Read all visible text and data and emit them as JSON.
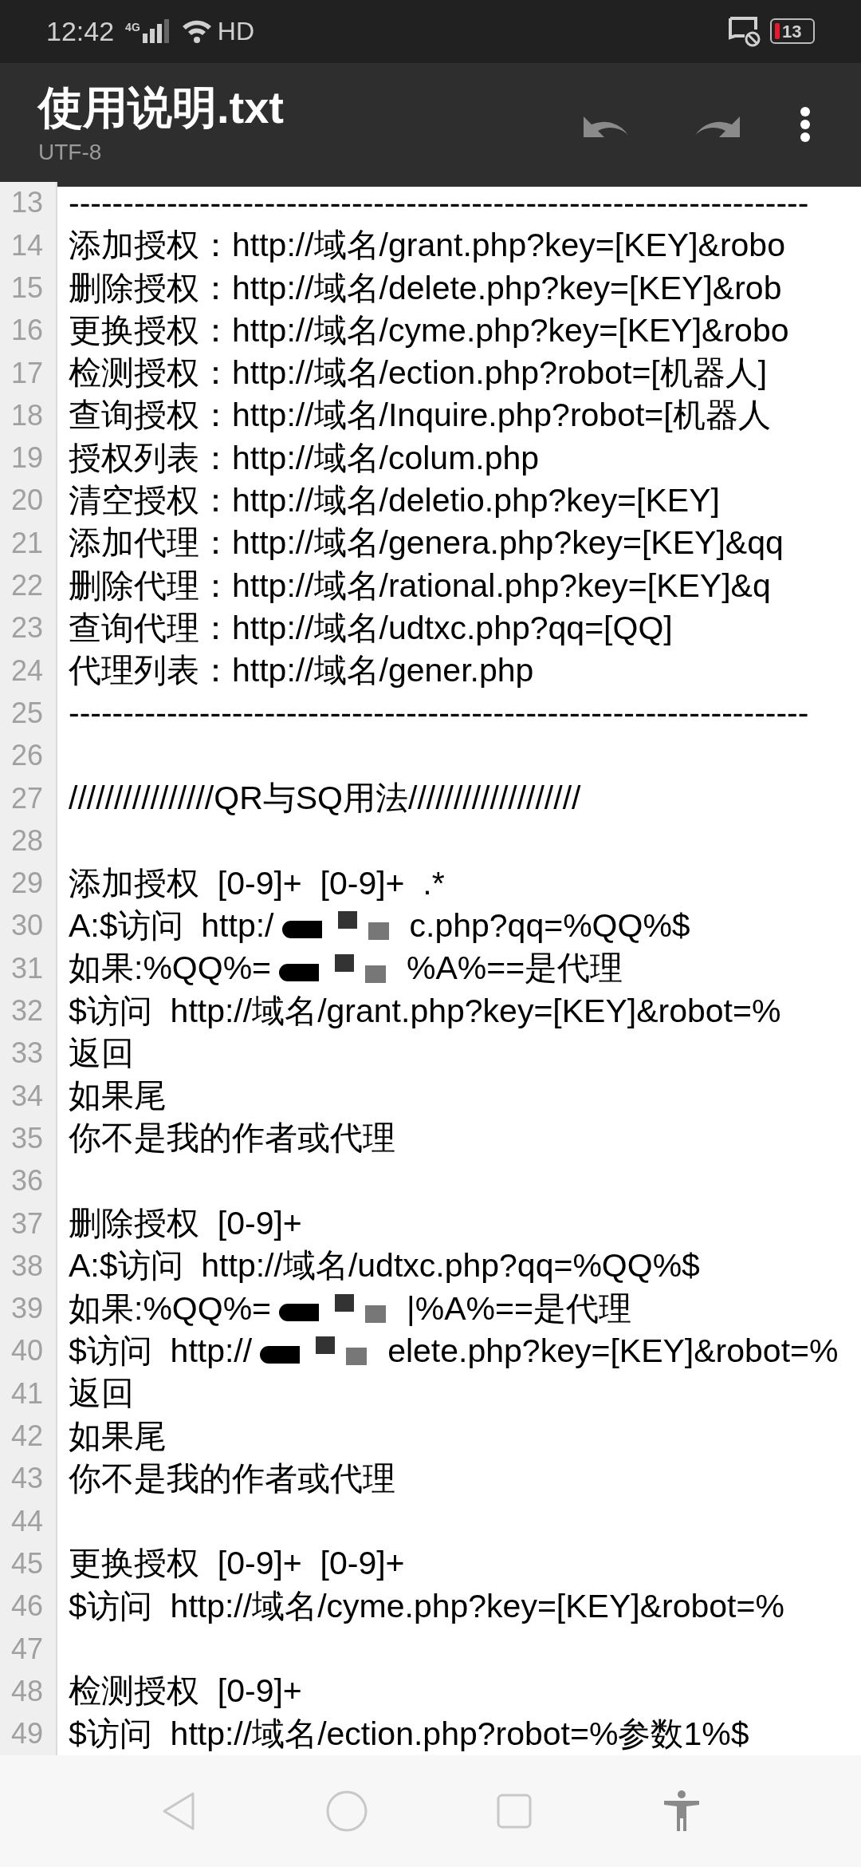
{
  "status_bar": {
    "time": "12:42",
    "network": "4G",
    "hd": "HD",
    "battery": "13"
  },
  "toolbar": {
    "title": "使用说明.txt",
    "encoding": "UTF-8"
  },
  "editor": {
    "lines": [
      {
        "number": "13",
        "text": "--------------------------------------------------------------------"
      },
      {
        "number": "14",
        "text": "添加授权：http://域名/grant.php?key=[KEY]&robo"
      },
      {
        "number": "15",
        "text": "删除授权：http://域名/delete.php?key=[KEY]&rob"
      },
      {
        "number": "16",
        "text": "更换授权：http://域名/cyme.php?key=[KEY]&robo"
      },
      {
        "number": "17",
        "text": "检测授权：http://域名/ection.php?robot=[机器人]"
      },
      {
        "number": "18",
        "text": "查询授权：http://域名/Inquire.php?robot=[机器人"
      },
      {
        "number": "19",
        "text": "授权列表：http://域名/colum.php"
      },
      {
        "number": "20",
        "text": "清空授权：http://域名/deletio.php?key=[KEY]"
      },
      {
        "number": "21",
        "text": "添加代理：http://域名/genera.php?key=[KEY]&qq"
      },
      {
        "number": "22",
        "text": "删除代理：http://域名/rational.php?key=[KEY]&q"
      },
      {
        "number": "23",
        "text": "查询代理：http://域名/udtxc.php?qq=[QQ]"
      },
      {
        "number": "24",
        "text": "代理列表：http://域名/gener.php"
      },
      {
        "number": "25",
        "text": "--------------------------------------------------------------------"
      },
      {
        "number": "26"
      },
      {
        "number": "27",
        "text": "////////////////QR与SQ用法///////////////////"
      },
      {
        "number": "28"
      },
      {
        "number": "29",
        "text": "添加授权  [0-9]+  [0-9]+  .*"
      },
      {
        "number": "30",
        "segments": [
          {
            "kind": "text",
            "text": "A:$访问  http:/"
          },
          {
            "kind": "redaction"
          },
          {
            "kind": "text",
            "text": "c.php?qq=%QQ%$"
          }
        ]
      },
      {
        "number": "31",
        "segments": [
          {
            "kind": "text",
            "text": "如果:%QQ%="
          },
          {
            "kind": "redaction"
          },
          {
            "kind": "text",
            "text": "%A%==是代理"
          }
        ]
      },
      {
        "number": "32",
        "text": "$访问  http://域名/grant.php?key=[KEY]&robot=%"
      },
      {
        "number": "33",
        "text": "返回"
      },
      {
        "number": "34",
        "text": "如果尾"
      },
      {
        "number": "35",
        "text": "你不是我的作者或代理"
      },
      {
        "number": "36"
      },
      {
        "number": "37",
        "text": "删除授权  [0-9]+"
      },
      {
        "number": "38",
        "text": "A:$访问  http://域名/udtxc.php?qq=%QQ%$"
      },
      {
        "number": "39",
        "segments": [
          {
            "kind": "text",
            "text": "如果:%QQ%="
          },
          {
            "kind": "redaction"
          },
          {
            "kind": "text",
            "text": "|%A%==是代理"
          }
        ]
      },
      {
        "number": "40",
        "segments": [
          {
            "kind": "text",
            "text": "$访问  http://"
          },
          {
            "kind": "redaction"
          },
          {
            "kind": "text",
            "text": "elete.php?key=[KEY]&robot=%"
          }
        ]
      },
      {
        "number": "41",
        "text": "返回"
      },
      {
        "number": "42",
        "text": "如果尾"
      },
      {
        "number": "43",
        "text": "你不是我的作者或代理"
      },
      {
        "number": "44"
      },
      {
        "number": "45",
        "text": "更换授权  [0-9]+  [0-9]+"
      },
      {
        "number": "46",
        "text": "$访问  http://域名/cyme.php?key=[KEY]&robot=%"
      },
      {
        "number": "47"
      },
      {
        "number": "48",
        "text": "检测授权  [0-9]+"
      },
      {
        "number": "49",
        "text": "$访问  http://域名/ection.php?robot=%参数1%$"
      }
    ]
  }
}
